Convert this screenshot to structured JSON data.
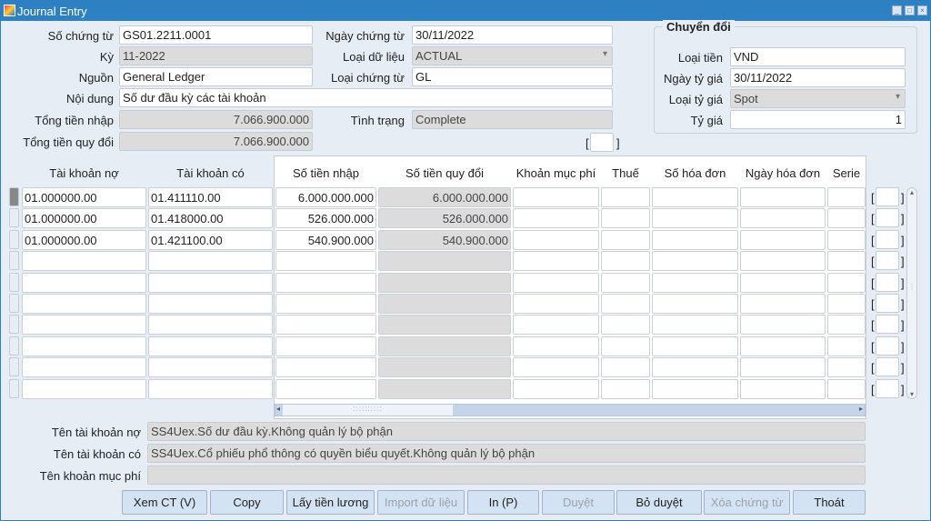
{
  "window": {
    "title": "Journal Entry"
  },
  "header": {
    "so_chung_tu": {
      "label": "Số chứng từ",
      "value": "GS01.2211.0001"
    },
    "ngay_chung_tu": {
      "label": "Ngày chứng từ",
      "value": "30/11/2022"
    },
    "ky": {
      "label": "Kỳ",
      "value": "11-2022"
    },
    "loai_du_lieu": {
      "label": "Loại dữ liệu",
      "value": "ACTUAL"
    },
    "nguon": {
      "label": "Nguồn",
      "value": "General Ledger"
    },
    "loai_chung_tu": {
      "label": "Loại chứng từ",
      "value": "GL"
    },
    "noi_dung": {
      "label": "Nội dung",
      "value": "Số dư đầu kỳ các tài khoản"
    },
    "tong_tien_nhap": {
      "label": "Tổng tiền nhập",
      "value": "7.066.900.000"
    },
    "tinh_trang": {
      "label": "Tình trạng",
      "value": "Complete"
    },
    "tong_tien_quy_doi": {
      "label": "Tổng tiền quy đổi",
      "value": "7.066.900.000"
    }
  },
  "conversion": {
    "title": "Chuyển đổi",
    "loai_tien": {
      "label": "Loại tiền",
      "value": "VND"
    },
    "ngay_ty_gia": {
      "label": "Ngày tỷ giá",
      "value": "30/11/2022"
    },
    "loai_ty_gia": {
      "label": "Loại tỷ giá",
      "value": "Spot"
    },
    "ty_gia": {
      "label": "Tỷ giá",
      "value": "1"
    }
  },
  "grid": {
    "columns": [
      "Tài khoản nợ",
      "Tài khoản có",
      "Số tiền nhập",
      "Số tiền quy đổi",
      "Khoản mục phí",
      "Thuế",
      "Số hóa đơn",
      "Ngày hóa đơn",
      "Serie"
    ],
    "rows": [
      [
        "01.000000.00",
        "01.411110.00",
        "6.000.000.000",
        "6.000.000.000",
        "",
        "",
        "",
        "",
        ""
      ],
      [
        "01.000000.00",
        "01.418000.00",
        "526.000.000",
        "526.000.000",
        "",
        "",
        "",
        "",
        ""
      ],
      [
        "01.000000.00",
        "01.421100.00",
        "540.900.000",
        "540.900.000",
        "",
        "",
        "",
        "",
        ""
      ],
      [
        "",
        "",
        "",
        "",
        "",
        "",
        "",
        "",
        ""
      ],
      [
        "",
        "",
        "",
        "",
        "",
        "",
        "",
        "",
        ""
      ],
      [
        "",
        "",
        "",
        "",
        "",
        "",
        "",
        "",
        ""
      ],
      [
        "",
        "",
        "",
        "",
        "",
        "",
        "",
        "",
        ""
      ],
      [
        "",
        "",
        "",
        "",
        "",
        "",
        "",
        "",
        ""
      ],
      [
        "",
        "",
        "",
        "",
        "",
        "",
        "",
        "",
        ""
      ],
      [
        "",
        "",
        "",
        "",
        "",
        "",
        "",
        "",
        ""
      ]
    ]
  },
  "details": {
    "ten_tk_no": {
      "label": "Tên tài khoản nợ",
      "value": "SS4Uex.Số dư đầu kỳ.Không quản lý bộ phận"
    },
    "ten_tk_co": {
      "label": "Tên tài khoản có",
      "value": "SS4Uex.Cổ phiếu phổ thông có quyền biểu quyết.Không quản lý bộ phận"
    },
    "ten_khoan_muc_phi": {
      "label": "Tên khoản mục phí",
      "value": ""
    }
  },
  "buttons": [
    {
      "label": "Xem CT (V)",
      "enabled": true
    },
    {
      "label": "Copy",
      "enabled": true
    },
    {
      "label": "Lấy tiền lương",
      "enabled": true
    },
    {
      "label": "Import dữ liệu",
      "enabled": false
    },
    {
      "label": "In (P)",
      "enabled": true
    },
    {
      "label": "Duyệt",
      "enabled": false
    },
    {
      "label": "Bỏ duyệt",
      "enabled": true
    },
    {
      "label": "Xóa chứng từ",
      "enabled": false
    },
    {
      "label": "Thoát",
      "enabled": true
    }
  ],
  "colors": {
    "titlebar": "#2d80c2",
    "background": "#e6edf5",
    "readonly": "#dcdcdc",
    "button": "#d4e3f3"
  }
}
